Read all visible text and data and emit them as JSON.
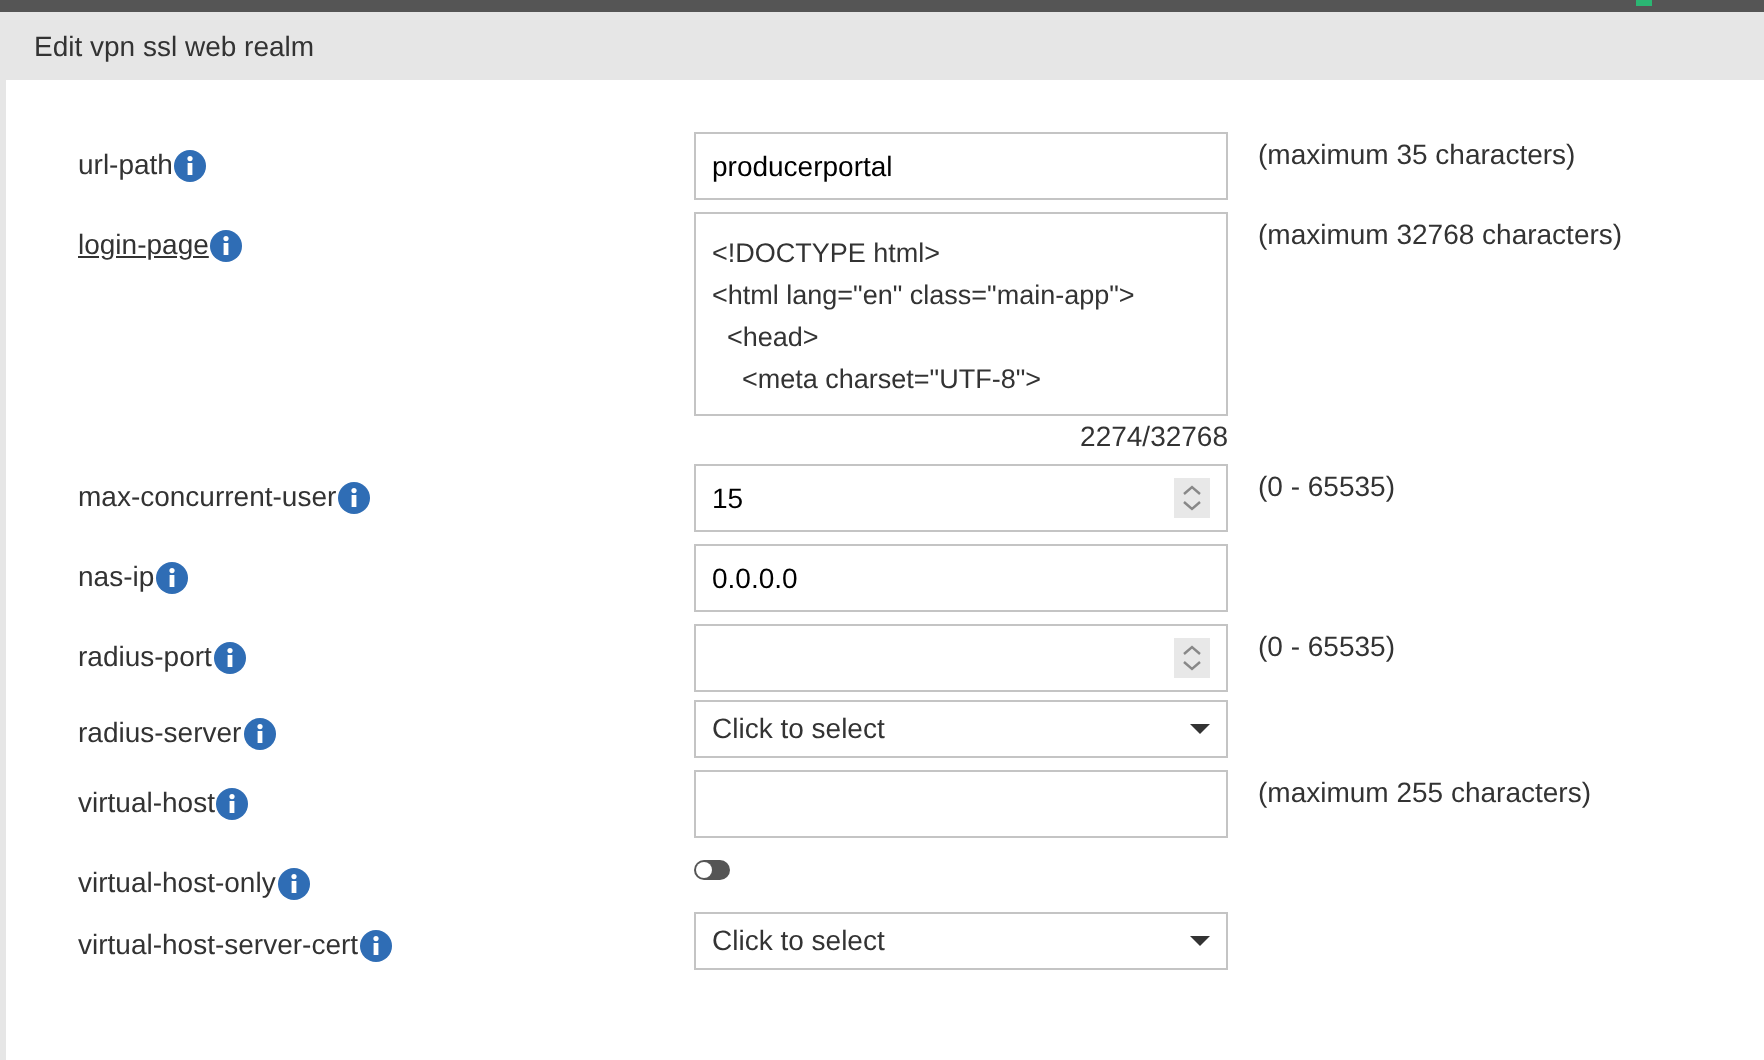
{
  "header": {
    "title": "Edit vpn ssl web realm"
  },
  "fields": [
    {
      "kind": "text",
      "label": "url-path",
      "link": false,
      "value": "producerportal",
      "hint": "(maximum 35 characters)"
    },
    {
      "kind": "textarea",
      "label": "login-page",
      "link": true,
      "lines": [
        "<!DOCTYPE html>",
        "<html lang=\"en\" class=\"main-app\">",
        "  <head>",
        "    <meta charset=\"UTF-8\">"
      ],
      "counter": "2274/32768",
      "hint": "(maximum 32768 characters)"
    },
    {
      "kind": "number",
      "label": "max-concurrent-user",
      "link": false,
      "value": "15",
      "hint": "(0 - 65535)"
    },
    {
      "kind": "text",
      "label": "nas-ip",
      "link": false,
      "value": "0.0.0.0"
    },
    {
      "kind": "number",
      "label": "radius-port",
      "link": false,
      "hint": "(0 - 65535)"
    },
    {
      "kind": "select",
      "label": "radius-server",
      "link": false,
      "value": "Click to select"
    },
    {
      "kind": "text",
      "label": "virtual-host",
      "link": false,
      "hint": "(maximum 255 characters)"
    },
    {
      "kind": "toggle",
      "label": "virtual-host-only",
      "link": false,
      "on": false
    },
    {
      "kind": "select",
      "label": "virtual-host-server-cert",
      "link": false,
      "value": "Click to select"
    }
  ]
}
